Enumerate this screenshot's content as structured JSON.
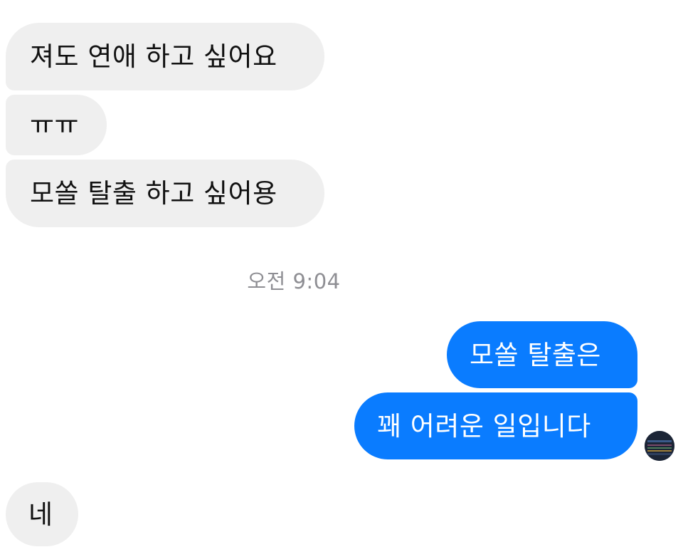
{
  "messages": [
    {
      "text": "져도 연애 하고 싶어요",
      "direction": "incoming"
    },
    {
      "text": "ㅠㅠ",
      "direction": "incoming"
    },
    {
      "text": "모쏠 탈출 하고 싶어용",
      "direction": "incoming"
    },
    {
      "text": "모쏠 탈출은",
      "direction": "outgoing"
    },
    {
      "text": "꽤 어려운 일입니다",
      "direction": "outgoing"
    },
    {
      "text": "네",
      "direction": "incoming"
    }
  ],
  "timestamp": "오전 9:04",
  "colors": {
    "incoming_bubble": "#efefef",
    "outgoing_bubble": "#0a7cff",
    "timestamp_text": "#8e8e93"
  },
  "icons": {
    "read_receipt": "avatar-icon"
  }
}
